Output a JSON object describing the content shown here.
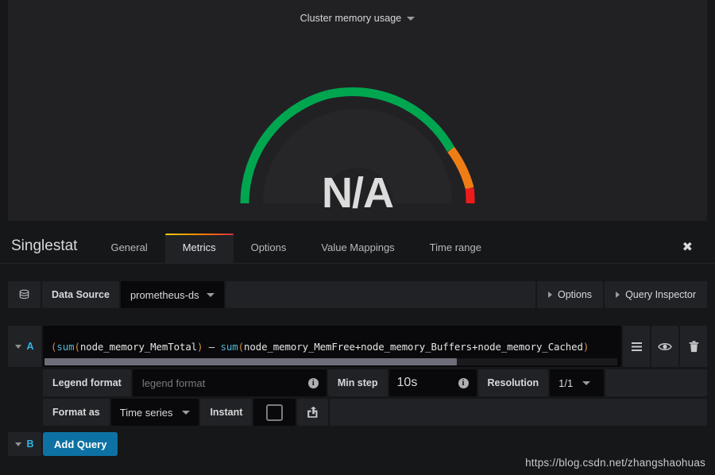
{
  "panel": {
    "title": "Cluster memory usage",
    "value": "N/A",
    "gauge": {
      "segments": [
        {
          "name": "green",
          "color": "#00a64f",
          "start_pct": 0,
          "end_pct": 73
        },
        {
          "name": "orange",
          "color": "#ef7d16",
          "start_pct": 73,
          "end_pct": 92
        },
        {
          "name": "red",
          "color": "#ef1b1b",
          "start_pct": 92,
          "end_pct": 100
        }
      ]
    }
  },
  "editor": {
    "name": "Singlestat",
    "tabs": [
      {
        "label": "General",
        "active": false
      },
      {
        "label": "Metrics",
        "active": true
      },
      {
        "label": "Options",
        "active": false
      },
      {
        "label": "Value Mappings",
        "active": false
      },
      {
        "label": "Time range",
        "active": false
      }
    ],
    "close_label": "✖"
  },
  "datasource": {
    "icon": "database-icon",
    "label": "Data Source",
    "value": "prometheus-ds",
    "options_label": "Options",
    "query_inspector_label": "Query Inspector"
  },
  "queries": [
    {
      "letter": "A",
      "expression_parts": [
        {
          "text": "(",
          "type": "paren"
        },
        {
          "text": "sum",
          "type": "fn"
        },
        {
          "text": "(",
          "type": "paren"
        },
        {
          "text": "node_memory_MemTotal",
          "type": "plain"
        },
        {
          "text": ")",
          "type": "paren"
        },
        {
          "text": " – ",
          "type": "op"
        },
        {
          "text": "sum",
          "type": "fn"
        },
        {
          "text": "(",
          "type": "paren"
        },
        {
          "text": "node_memory_MemFree+node_memory_Buffers+node_memory_Cached",
          "type": "plain"
        },
        {
          "text": ")",
          "type": "paren"
        }
      ],
      "expression_plain": "(sum(node_memory_MemTotal) – sum(node_memory_MemFree+node_memory_Buffers+node_memory_Cached)",
      "legend_format_label": "Legend format",
      "legend_format_value": "",
      "legend_format_placeholder": "legend format",
      "min_step_label": "Min step",
      "min_step_value": "10s",
      "resolution_label": "Resolution",
      "resolution_value": "1/1",
      "format_as_label": "Format as",
      "format_as_value": "Time series",
      "instant_label": "Instant",
      "instant_checked": false,
      "actions": [
        "list-icon",
        "eye-icon",
        "trash-icon",
        "external-link-icon"
      ]
    },
    {
      "letter": "B",
      "add_query_label": "Add Query"
    }
  ],
  "watermark": "https://blog.csdn.net/zhangshaohuas",
  "colors": {
    "accent_blue": "#33b5e5",
    "button_blue": "#0d72a3",
    "tab_gradient_start": "#f2cc0c",
    "tab_gradient_end": "#e02f44",
    "panel_bg": "#212124",
    "editor_bg": "#161719",
    "input_bg": "#09090b",
    "segment_bg": "#202226"
  }
}
